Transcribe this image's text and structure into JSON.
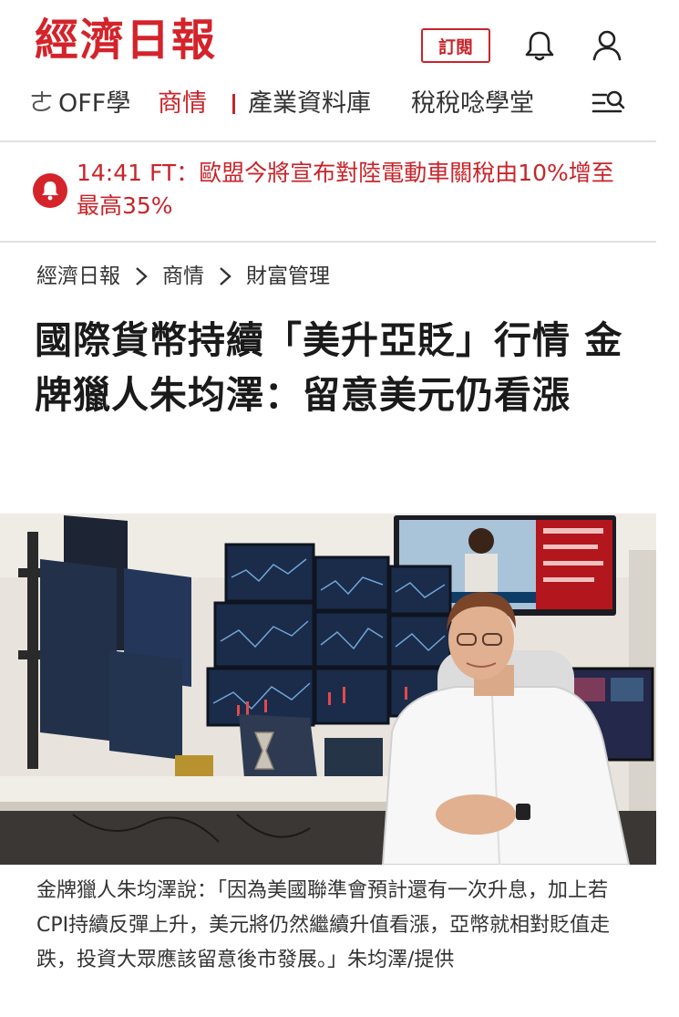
{
  "header": {
    "logo_text": "經濟日報",
    "subscribe_label": "訂閱",
    "bell_icon": "bell-icon",
    "user_icon": "user-icon"
  },
  "nav": {
    "partial_label": "ㄜ",
    "items": [
      {
        "label": "OFF學"
      },
      {
        "label": "商情"
      },
      {
        "label": "產業資料庫"
      },
      {
        "label": "稅稅唸學堂"
      }
    ],
    "menu_icon": "menu-search-icon"
  },
  "breaking": {
    "icon": "alert-bell-icon",
    "text": "14:41 FT：歐盟今將宣布對陸電動車關稅由10%增至最高35%"
  },
  "breadcrumb": [
    "經濟日報",
    "商情",
    "財富管理"
  ],
  "article": {
    "title": "國際貨幣持續「美升亞貶」行情 金牌獵人朱均澤：留意美元仍看漲",
    "caption": "金牌獵人朱均澤說：「因為美國聯準會預計還有一次升息，加上若CPI持續反彈上升，美元將仍然繼續升值看漲，亞幣就相對貶值走跌，投資大眾應該留意後市發展。」朱均澤/提供"
  },
  "colors": {
    "brand_red": "#d4232a",
    "text_dark": "#1a1a1a",
    "divider": "#e2e2e2"
  }
}
